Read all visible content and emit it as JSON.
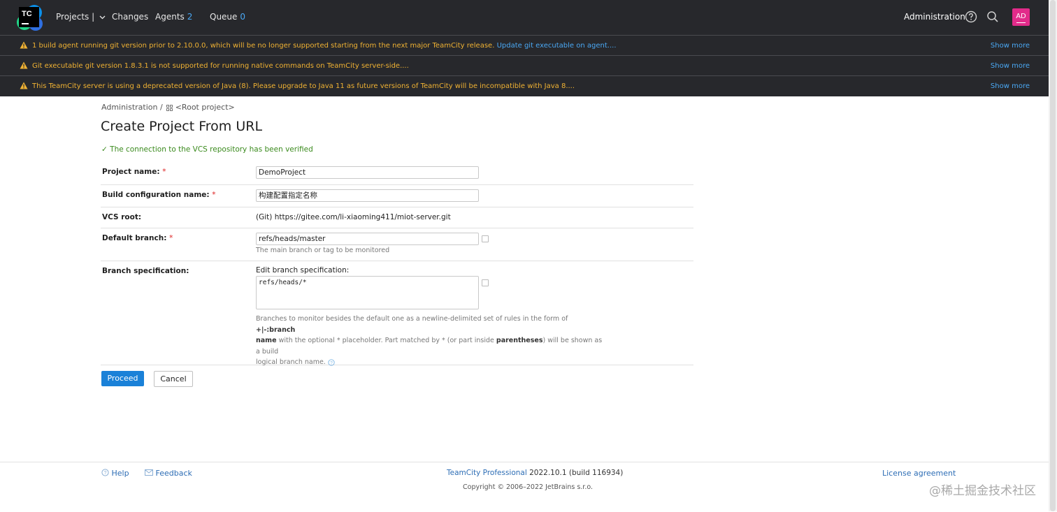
{
  "nav": {
    "projects_label": "Projects |",
    "changes_label": "Changes",
    "agents_label": "Agents",
    "agents_count": "2",
    "queue_label": "Queue",
    "queue_count": "0",
    "administration_label": "Administration",
    "avatar_initials": "AD",
    "logo_text": "TC"
  },
  "warnings": [
    {
      "text": "1 build agent running git version prior to 2.10.0.0, which will be no longer supported starting from the next major TeamCity release.",
      "link": "Update git executable on agent....",
      "show_more": "Show more"
    },
    {
      "text": "Git executable git version 1.8.3.1 is not supported for running native commands on TeamCity server-side....",
      "link": "",
      "show_more": "Show more"
    },
    {
      "text": "This TeamCity server is using a deprecated version of Java (8). Please upgrade to Java 11 as future versions of TeamCity will be incompatible with Java 8....",
      "link": "",
      "show_more": "Show more"
    }
  ],
  "breadcrumb": {
    "root": "Administration",
    "separator": "/",
    "project": "<Root project>"
  },
  "page_title": "Create Project From URL",
  "verified_message": "The connection to the VCS repository has been verified",
  "form": {
    "project_name_label": "Project name:",
    "project_name_value": "DemoProject",
    "build_config_label": "Build configuration name:",
    "build_config_value": "构建配置指定名称",
    "vcs_root_label": "VCS root:",
    "vcs_root_value": "(Git) https://gitee.com/li-xiaoming411/miot-server.git",
    "default_branch_label": "Default branch:",
    "default_branch_value": "refs/heads/master",
    "default_branch_hint": "The main branch or tag to be monitored",
    "branch_spec_label": "Branch specification:",
    "branch_spec_edit_label": "Edit branch specification:",
    "branch_spec_value": "refs/heads/*",
    "branch_spec_hint_1": "Branches to monitor besides the default one as a newline-delimited set of rules in the form of",
    "branch_spec_hint_bold_1": "+|-:branch",
    "branch_spec_hint_bold_2": "name",
    "branch_spec_hint_2": "with the optional * placeholder. Part matched by * (or part inside",
    "branch_spec_hint_bold_3": "parentheses",
    "branch_spec_hint_3": ") will be shown as a build",
    "branch_spec_hint_4": "logical branch name.",
    "required_mark": "*"
  },
  "buttons": {
    "proceed": "Proceed",
    "cancel": "Cancel"
  },
  "footer": {
    "help": "Help",
    "feedback": "Feedback",
    "product_link": "TeamCity Professional",
    "version": "2022.10.1 (build 116934)",
    "copyright": "Copyright © 2006–2022 JetBrains s.r.o.",
    "license": "License agreement"
  },
  "watermark": "@稀土掘金技术社区",
  "colors": {
    "header_bg": "#27282c",
    "warning": "#f0b233",
    "link": "#4aa8f4",
    "primary": "#1a81d8",
    "verified": "#3a8a1d",
    "avatar": "#e22b8a"
  }
}
